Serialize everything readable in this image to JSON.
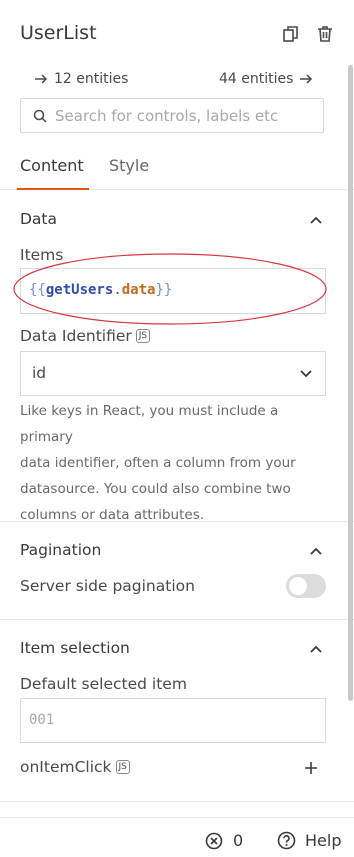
{
  "header": {
    "title": "UserList",
    "copy_icon": "copy-icon",
    "delete_icon": "trash-icon"
  },
  "entities": {
    "left": "12 entities",
    "right": "44 entities"
  },
  "search": {
    "placeholder": "Search for controls, labels etc",
    "value": ""
  },
  "tabs": [
    {
      "label": "Content",
      "active": true
    },
    {
      "label": "Style",
      "active": false
    }
  ],
  "data_section": {
    "title": "Data",
    "items_label": "Items",
    "items_value": {
      "open": "{{",
      "object": "getUsers",
      "dot": ".",
      "prop": "data",
      "close": "}}"
    },
    "identifier_label": "Data Identifier",
    "js_badge": "JS",
    "identifier_value": "id",
    "help_lines": [
      "Like keys in React, you must include a primary",
      "data identifier, often a column from your",
      "datasource. You could also combine two",
      "columns or data attributes."
    ]
  },
  "pagination": {
    "title": "Pagination",
    "server_side_label": "Server side pagination",
    "server_side_enabled": false
  },
  "item_selection": {
    "title": "Item selection",
    "default_label": "Default selected item",
    "default_placeholder": "001",
    "on_click_label": "onItemClick",
    "js_badge": "JS"
  },
  "footer": {
    "errors_count": "0",
    "help_label": "Help"
  },
  "colors": {
    "accent": "#e15615",
    "annotation": "#d9353f",
    "code_blue": "#2f4da7",
    "code_orange": "#c26b1d"
  }
}
